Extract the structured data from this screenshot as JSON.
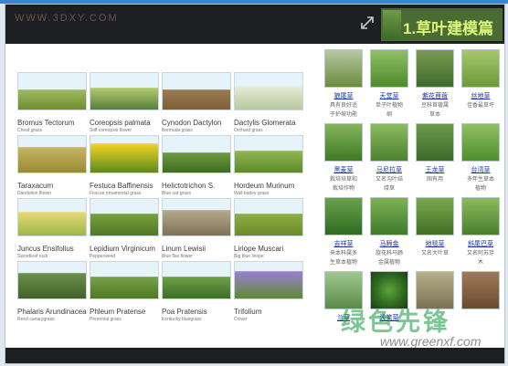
{
  "header": {
    "watermark": "WWW.3DXY.COM",
    "title": "1.草叶建模篇"
  },
  "icons": {
    "expand": "expand-icon"
  },
  "species": [
    {
      "name": "Bromus Tectorum",
      "sub": "Cheat grass"
    },
    {
      "name": "Coreopsis palmata",
      "sub": "Stiff coreopsis flower"
    },
    {
      "name": "Cynodon Dactylon",
      "sub": "Bermuda grass"
    },
    {
      "name": "Dactylis Glomerata",
      "sub": "Orchard grass"
    },
    {
      "name": "Taraxacum",
      "sub": "Dandelion flower"
    },
    {
      "name": "Festuca Baffinensis",
      "sub": "Fescue ornamental grass"
    },
    {
      "name": "Helictotrichon S.",
      "sub": "Blue oat grass"
    },
    {
      "name": "Hordeum Murinum",
      "sub": "Wall barley grass"
    },
    {
      "name": "Juncus Ensifolius",
      "sub": "Swordleaf rush"
    },
    {
      "name": "Lepidium Virginicum",
      "sub": "Pepperweed"
    },
    {
      "name": "Linum Lewisii",
      "sub": "Blue flax flower"
    },
    {
      "name": "Liriope Muscari",
      "sub": "Big blue liriope"
    },
    {
      "name": "Phalaris Arundinacea",
      "sub": "Reed canarygrass"
    },
    {
      "name": "Phleum Pratense",
      "sub": "Perennial grass"
    },
    {
      "name": "Poa Pratensis",
      "sub": "Kentucky bluegrass"
    },
    {
      "name": "Trifolium",
      "sub": "Clover"
    }
  ],
  "grasses": [
    {
      "name": "狼尾草",
      "desc": [
        "具有良好适",
        "于护坡功能"
      ]
    },
    {
      "name": "天堂草",
      "desc": [
        "单子叶植物",
        "纲"
      ]
    },
    {
      "name": "紫花苜蓿",
      "desc": [
        "豆科苜蓿属",
        "草本"
      ]
    },
    {
      "name": "丝地草",
      "desc": [
        "佳香最草坪"
      ]
    },
    {
      "name": "黑麦草",
      "desc": [
        "栽培培草和",
        "栽培作物"
      ]
    },
    {
      "name": "马尼拉草",
      "desc": [
        "又名沟叶结",
        "缕草"
      ]
    },
    {
      "name": "王龙草",
      "desc": [
        "固有用"
      ]
    },
    {
      "name": "台湾草",
      "desc": [
        "多年生草本",
        "植物"
      ]
    },
    {
      "name": "吉祥草",
      "desc": [
        "来本科属多",
        "生草本植物"
      ]
    },
    {
      "name": "马蹄金",
      "desc": [
        "旋花科马蹄",
        "金属植物"
      ]
    },
    {
      "name": "地毯草",
      "desc": [
        "又名大叶草"
      ]
    },
    {
      "name": "斜尾巴草",
      "desc": [
        "又名阿苏芽",
        "木"
      ]
    },
    {
      "name": "兰草",
      "desc": []
    },
    {
      "name": "浅笑菜",
      "desc": []
    },
    {
      "name": "",
      "desc": []
    },
    {
      "name": "",
      "desc": []
    }
  ],
  "watermark": {
    "text": "绿色先锋",
    "url": "www.greenxf.com"
  }
}
